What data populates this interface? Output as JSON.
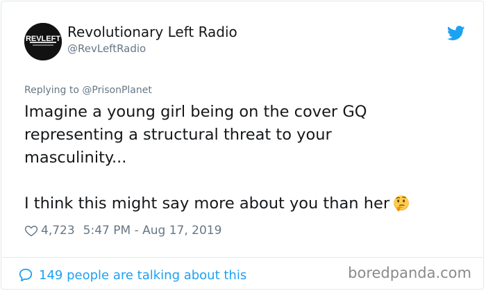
{
  "account": {
    "display_name": "Revolutionary Left Radio",
    "handle": "@RevLeftRadio",
    "avatar_text": "REVLEFT"
  },
  "reply_context": "Replying to @PrisonPlanet",
  "tweet": {
    "text": "Imagine a young girl being on the cover GQ\nrepresenting a structural threat to your\nmasculinity...\n\nI think this might say more about you than her",
    "emoji": "thinking-face"
  },
  "meta": {
    "likes": "4,723",
    "time": "5:47 PM - Aug 17, 2019"
  },
  "footer": {
    "talking": "149 people are talking about this",
    "credit": "boredpanda.com"
  },
  "colors": {
    "twitter_blue": "#1da1f2",
    "text": "#14171a",
    "muted": "#657786",
    "border": "#e1e8ed"
  },
  "icons": [
    "twitter-bird-icon",
    "heart-icon",
    "speech-bubble-icon",
    "thinking-face-emoji"
  ]
}
